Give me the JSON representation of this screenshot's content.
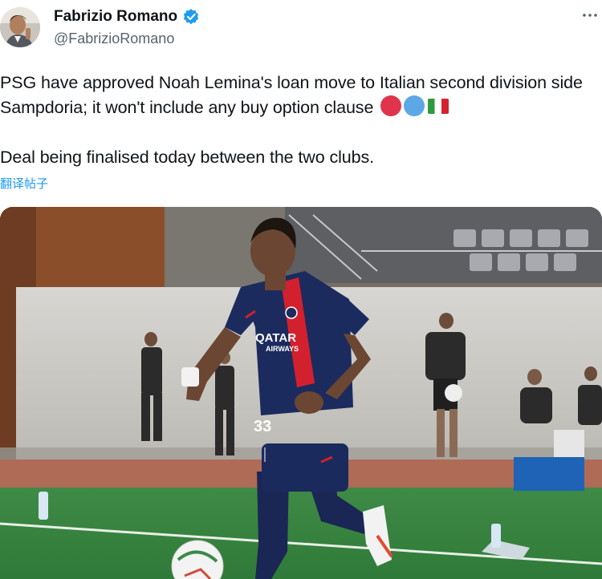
{
  "author": {
    "display_name": "Fabrizio Romano",
    "handle": "@FabrizioRomano",
    "verified": true,
    "avatar_icon": "avatar-photo"
  },
  "tweet": {
    "paragraph_1": "PSG have approved Noah Lemina's loan move to Italian second division side Sampdoria; it won't include any buy option clause",
    "paragraph_2": "Deal being finalised today between the two clubs.",
    "emojis": [
      "red-circle",
      "blue-circle",
      "italy-flag"
    ],
    "translate_label": "翻译帖子"
  },
  "media": {
    "description_icon": "football-player-photo",
    "sponsor_text": "QATAR",
    "sponsor_subtext": "AIRWAYS",
    "shirt_number": "33"
  },
  "colors": {
    "link": "#1d9bf0",
    "verified": "#1d9bf0",
    "secondary_text": "#536471",
    "primary_text": "#0f1419"
  }
}
